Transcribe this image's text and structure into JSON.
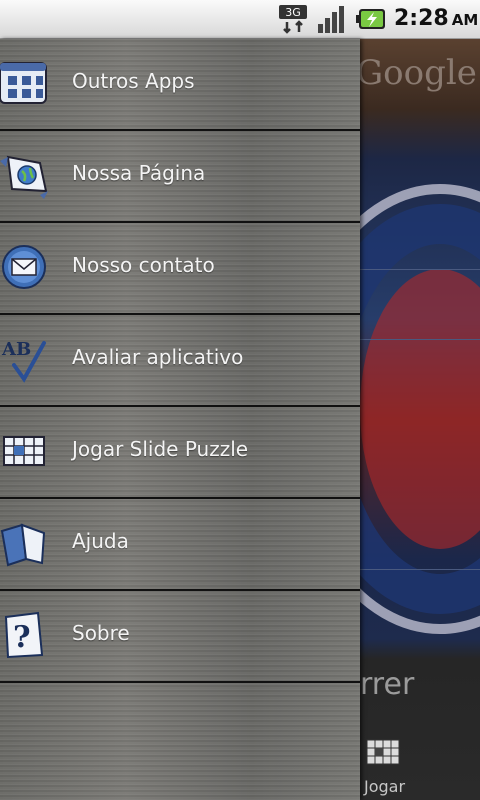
{
  "statusbar": {
    "time": "2:28",
    "ampm": "AM",
    "network": "3G"
  },
  "background": {
    "search_brand": "Google",
    "bottom_text": "rrer",
    "tab_label": "Jogar"
  },
  "menu": {
    "items": [
      {
        "label": "Outros Apps",
        "icon": "apps-grid-icon"
      },
      {
        "label": "Nossa Página",
        "icon": "globe-page-icon"
      },
      {
        "label": "Nosso contato",
        "icon": "email-icon"
      },
      {
        "label": "Avaliar aplicativo",
        "icon": "rate-ab-check-icon"
      },
      {
        "label": "Jogar Slide Puzzle",
        "icon": "puzzle-grid-icon"
      },
      {
        "label": "Ajuda",
        "icon": "book-help-icon"
      },
      {
        "label": "Sobre",
        "icon": "question-mark-icon"
      }
    ]
  }
}
